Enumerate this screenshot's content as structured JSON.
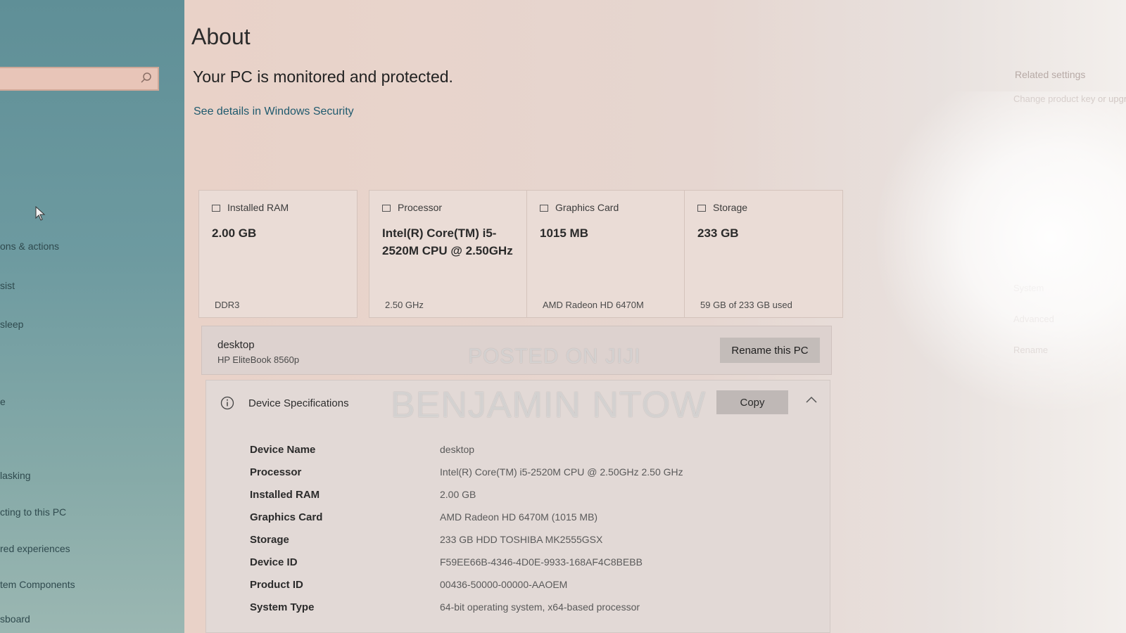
{
  "sidebar": {
    "search": {
      "value": "",
      "placeholder": ""
    },
    "items": [
      "ons & actions",
      "sist",
      "sleep",
      "e",
      "lasking",
      "cting to this PC",
      "red experiences",
      "tem Components",
      "sboard"
    ]
  },
  "about": {
    "title": "About",
    "protection_status": "Your PC is monitored and protected.",
    "security_link": "See details in Windows Security"
  },
  "cards": [
    {
      "label": "Installed RAM",
      "value": "2.00 GB",
      "sub": "DDR3"
    },
    {
      "label": "Processor",
      "value": "Intel(R) Core(TM) i5-2520M CPU @ 2.50GHz",
      "sub": "2.50 GHz"
    },
    {
      "label": "Graphics Card",
      "value": "1015 MB",
      "sub": "AMD Radeon HD 6470M"
    },
    {
      "label": "Storage",
      "value": "233 GB",
      "sub": "59 GB of 233 GB used"
    }
  ],
  "pc": {
    "name": "desktop",
    "model": "HP EliteBook 8560p",
    "rename_label": "Rename this PC"
  },
  "specs": {
    "title": "Device Specifications",
    "copy_label": "Copy",
    "rows": [
      {
        "label": "Device Name",
        "value": "desktop"
      },
      {
        "label": "Processor",
        "value": "Intel(R) Core(TM) i5-2520M CPU @ 2.50GHz   2.50 GHz"
      },
      {
        "label": "Installed RAM",
        "value": "2.00 GB"
      },
      {
        "label": "Graphics Card",
        "value": "AMD Radeon HD 6470M (1015 MB)"
      },
      {
        "label": "Storage",
        "value": "233 GB HDD TOSHIBA MK2555GSX"
      },
      {
        "label": "Device ID",
        "value": "F59EE66B-4346-4D0E-9933-168AF4C8BEBB"
      },
      {
        "label": "Product ID",
        "value": "00436-50000-00000-AAOEM"
      },
      {
        "label": "System Type",
        "value": "64-bit operating system, x64-based processor"
      }
    ]
  },
  "related": {
    "title": "Related settings",
    "links": [
      "Change product key or upgrade",
      "System",
      "Advanced",
      "Rename"
    ]
  },
  "watermark": {
    "line1": "POSTED ON JIJI",
    "line2": "BENJAMIN NTOW"
  }
}
